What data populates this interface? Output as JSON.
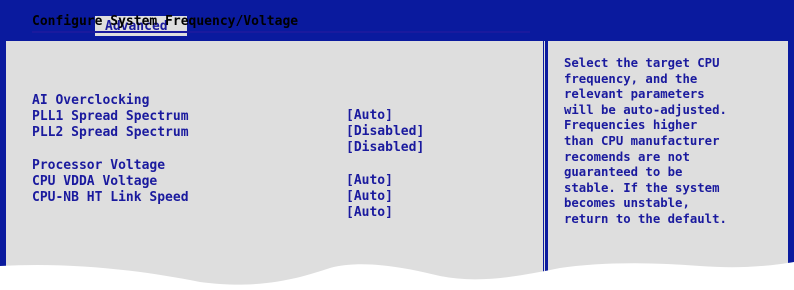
{
  "tabs": {
    "active": "Advanced"
  },
  "section": {
    "title": "Configure System Frequency/Voltage"
  },
  "settings": [
    {
      "label": "AI Overclocking",
      "value": "[Auto]"
    },
    {
      "label": "PLL1 Spread Spectrum",
      "value": "[Disabled]"
    },
    {
      "label": "PLL2 Spread Spectrum",
      "value": "[Disabled]"
    },
    {
      "label": "Processor Voltage",
      "value": "[Auto]"
    },
    {
      "label": "CPU VDDA Voltage",
      "value": "[Auto]"
    },
    {
      "label": "CPU-NB HT Link Speed",
      "value": "[Auto]"
    }
  ],
  "help": {
    "lines": [
      "Select the target CPU",
      "frequency, and the",
      "relevant parameters",
      "will be auto-adjusted.",
      "Frequencies higher",
      "than CPU manufacturer",
      "recomends are not",
      "guaranteed to be",
      "stable. If the system",
      "becomes unstable,",
      "return to the default."
    ]
  },
  "colors": {
    "frame": "#0a1a9e",
    "panel": "#dedede",
    "text": "#1a1a9e"
  }
}
